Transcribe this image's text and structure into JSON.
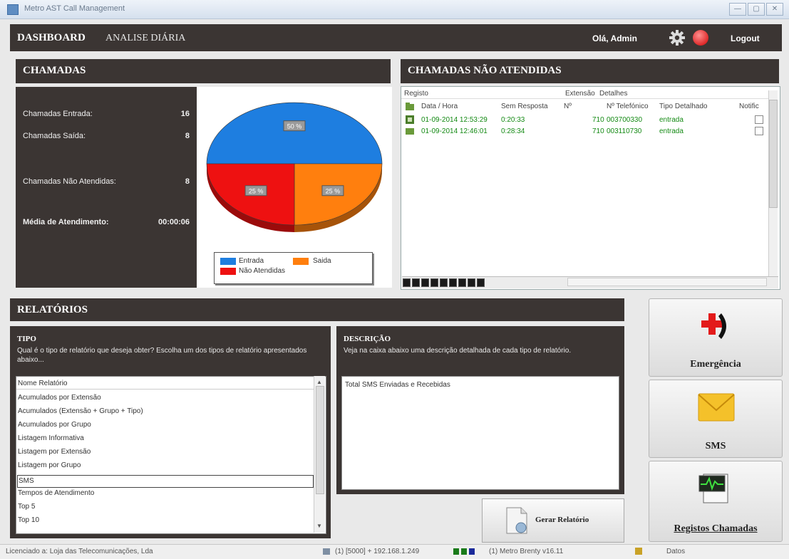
{
  "window": {
    "title": "Metro AST Call Management",
    "buttons": [
      "—",
      "▢",
      "✕"
    ]
  },
  "header": {
    "title": "DASHBOARD",
    "subtitle": "ANALISE DIÁRIA",
    "greeting": "Olá, Admin",
    "logout": "Logout"
  },
  "chamadas": {
    "title": "CHAMADAS",
    "stats": [
      {
        "label": "Chamadas Entrada:",
        "value": "16"
      },
      {
        "label": "Chamadas Saída:",
        "value": "8"
      },
      {
        "label": "Chamadas Não Atendidas:",
        "value": "8"
      },
      {
        "label": "Média de Atendimento:",
        "value": "00:00:06"
      }
    ],
    "legend": [
      "Entrada",
      "Saida",
      "Não Atendidas"
    ]
  },
  "chart_data": {
    "type": "pie",
    "categories": [
      "Entrada",
      "Saida",
      "Não Atendidas"
    ],
    "values": [
      50,
      25,
      25
    ],
    "data_labels": [
      "50 %",
      "25 %",
      "25 %"
    ],
    "colors": [
      "#1e7ee0",
      "#ff7f0e",
      "#ee1111"
    ],
    "legend": "bottom"
  },
  "nao_atendidas": {
    "title": "CHAMADAS NÃO ATENDIDAS",
    "group_headers": [
      "Registo",
      "Extensão",
      "Detalhes"
    ],
    "columns": [
      "Data / Hora",
      "Sem Resposta",
      "Nº",
      "Nº Telefónico",
      "Tipo Detalhado",
      "Notific"
    ],
    "rows": [
      [
        "01-09-2014 12:53:29",
        "0:20:33",
        "710",
        "003700330",
        "entrada"
      ],
      [
        "01-09-2014 12:46:01",
        "0:28:34",
        "710",
        "003110730",
        "entrada"
      ]
    ]
  },
  "relatorios": {
    "title": "RELATÓRIOS",
    "tipo": {
      "title": "TIPO",
      "text": "Qual é o tipo de relatório que deseja obter? Escolha um dos tipos de relatório apresentados abaixo...",
      "list_header": "Nome Relatório",
      "items": [
        "Acumulados por Extensão",
        "Acumulados (Extensão + Grupo + Tipo)",
        "Acumulados por Grupo",
        "Listagem Informativa",
        "Listagem por Extensão",
        "Listagem por Grupo",
        "SMS",
        "Tempos de Atendimento",
        "Top 5",
        "Top 10"
      ],
      "selected": "SMS"
    },
    "descricao": {
      "title": "DESCRIÇÃO",
      "text": "Veja na caixa abaixo uma descrição detalhada de cada tipo de relatório.",
      "value": "Total SMS Enviadas e Recebidas"
    },
    "gerar_label": "Gerar Relatório"
  },
  "tiles": {
    "emergencia": "Emergência",
    "sms": "SMS",
    "registos": "Registos Chamadas"
  },
  "status": {
    "license": "Licenciado a: Loja das Telecomunicações, Lda",
    "server": "(1) [5000] + 192.168.1.249",
    "user": "(1) Metro Brenty v16.11",
    "extra": "Datos"
  }
}
